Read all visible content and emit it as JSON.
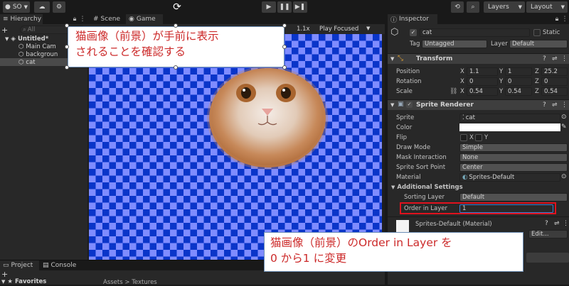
{
  "toolbar": {
    "account": "SO",
    "layers": "Layers",
    "layout": "Layout"
  },
  "hierarchy": {
    "tab": "Hierarchy",
    "search_placeholder": "All",
    "scene": "Untitled*",
    "items": [
      "Main Cam",
      "backgroun",
      "cat"
    ]
  },
  "scene_view": {
    "tabs": [
      "Scene",
      "Game"
    ],
    "zoom": "1.1x",
    "play_mode": "Play Focused"
  },
  "inspector": {
    "tab": "Inspector",
    "object_name": "cat",
    "static_label": "Static",
    "tag_label": "Tag",
    "tag_value": "Untagged",
    "layer_label": "Layer",
    "layer_value": "Default",
    "transform": {
      "title": "Transform",
      "position_label": "Position",
      "rotation_label": "Rotation",
      "scale_label": "Scale",
      "position": [
        "1.1",
        "1",
        "25.2"
      ],
      "rotation": [
        "0",
        "0",
        "0"
      ],
      "scale": [
        "0.54",
        "0.54",
        "0.54"
      ],
      "axis": [
        "X",
        "Y",
        "Z"
      ]
    },
    "sprite_renderer": {
      "title": "Sprite Renderer",
      "sprite_label": "Sprite",
      "sprite_value": "cat",
      "color_label": "Color",
      "flip_label": "Flip",
      "flip_x": "X",
      "flip_y": "Y",
      "draw_mode_label": "Draw Mode",
      "draw_mode": "Simple",
      "mask_label": "Mask Interaction",
      "mask_value": "None",
      "sort_point_label": "Sprite Sort Point",
      "sort_point": "Center",
      "material_label": "Material",
      "material_value": "Sprites-Default",
      "additional": "Additional Settings",
      "sorting_layer_label": "Sorting Layer",
      "sorting_layer": "Default",
      "order_label": "Order in Layer",
      "order_value": "1"
    },
    "material_block": {
      "name": "Sprites-Default (Material)",
      "shader_btn": "Edit..."
    }
  },
  "bottom": {
    "tabs": [
      "Project",
      "Console"
    ],
    "favorites": "Favorites",
    "breadcrumb": "Assets > Textures"
  },
  "callouts": {
    "top_line1": "猫画像（前景）が手前に表示",
    "top_line2": "されることを確認する",
    "bottom_line1": "猫画像（前景）のOrder in Layer を",
    "bottom_line2": "0 から1 に変更"
  },
  "colors": {
    "highlight": "#e0121e",
    "checker_a": "#0a35c9",
    "checker_b": "#7f8cff"
  }
}
